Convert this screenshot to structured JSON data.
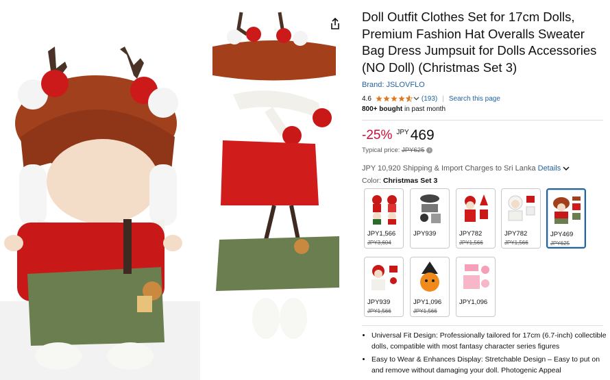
{
  "product": {
    "title": "Doll Outfit Clothes Set for 17cm Dolls, Premium Fashion Hat Overalls Sweater Bag Dress Jumpsuit for Dolls Accessories (NO Doll) (Christmas Set 3)",
    "brand": "Brand: JSLOVFLO",
    "rating": "4.6",
    "rating_count": "(193)",
    "search_link": "Search this page",
    "bought_bold": "800+ bought",
    "bought_rest": " in past month"
  },
  "price": {
    "discount": "-25%",
    "currency": "JPY",
    "value": "469",
    "typical_label": "Typical price: ",
    "typical_value": "JPY625"
  },
  "shipping": {
    "text": "JPY 10,920 Shipping & Import Charges to Sri Lanka ",
    "details": "Details"
  },
  "color": {
    "label": "Color: ",
    "selected": "Christmas Set 3"
  },
  "swatches": [
    {
      "price": "JPY1,566",
      "old": "JPY3,604"
    },
    {
      "price": "JPY939",
      "old": ""
    },
    {
      "price": "JPY782",
      "old": "JPY1,566"
    },
    {
      "price": "JPY782",
      "old": "JPY1,566"
    },
    {
      "price": "JPY469",
      "old": "JPY625"
    },
    {
      "price": "JPY939",
      "old": "JPY1,566"
    },
    {
      "price": "JPY1,096",
      "old": "JPY1,566"
    },
    {
      "price": "JPY1,096",
      "old": ""
    }
  ],
  "bullets": [
    "Universal Fit Design: Professionally tailored for 17cm (6.7-inch) collectible dolls, compatible with most fantasy character series figures",
    "Easy to Wear & Enhances Display: Stretchable Design – Easy to put on and remove without damaging your doll. Photogenic Appeal"
  ],
  "colors": {
    "link": "#2162a1",
    "discount": "#cc0c39",
    "star": "#de7921",
    "selected_border": "#2162a1"
  },
  "icons": [
    "share-icon",
    "star-icon",
    "chevron-down-icon",
    "info-icon"
  ]
}
